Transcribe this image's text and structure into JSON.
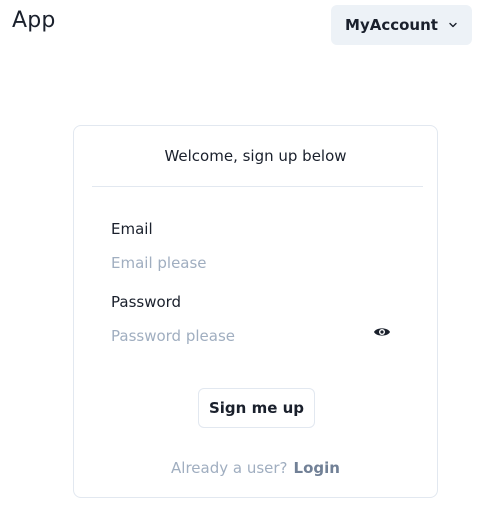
{
  "header": {
    "app_title": "App",
    "account_label": "MyAccount",
    "account_icon": "chevron-down-icon"
  },
  "card": {
    "title": "Welcome, sign up below",
    "email": {
      "label": "Email",
      "placeholder": "Email please",
      "value": ""
    },
    "password": {
      "label": "Password",
      "placeholder": "Password please",
      "value": "",
      "toggle_icon": "eye-icon"
    },
    "submit_label": "Sign me up",
    "footer_text": "Already a user?",
    "login_label": "Login"
  },
  "colors": {
    "text": "#1a202c",
    "placeholder": "#a0aec0",
    "muted_link": "#718096",
    "account_button_bg": "#edf2f7",
    "border": "#e2e8f0"
  }
}
